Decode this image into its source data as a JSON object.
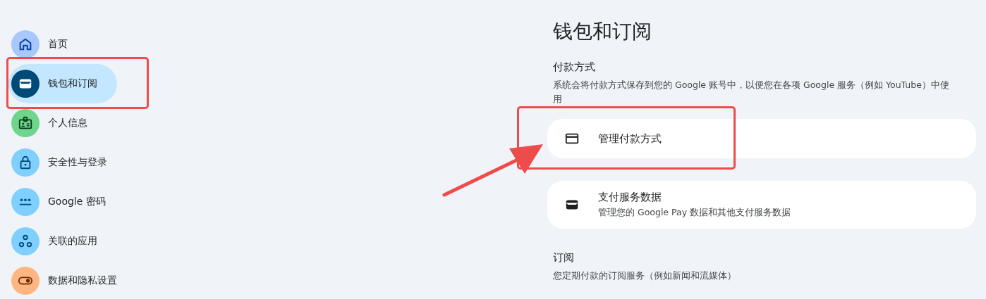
{
  "sidebar": {
    "items": [
      {
        "label": "首页",
        "kind": "home",
        "selected": false,
        "annotated": false
      },
      {
        "label": "钱包和订阅",
        "kind": "wallet",
        "selected": true,
        "annotated": true
      },
      {
        "label": "个人信息",
        "kind": "badge",
        "selected": false,
        "annotated": false
      },
      {
        "label": "安全性与登录",
        "kind": "lock",
        "selected": false,
        "annotated": false
      },
      {
        "label": "Google 密码",
        "kind": "password",
        "selected": false,
        "annotated": false
      },
      {
        "label": "关联的应用",
        "kind": "apps",
        "selected": false,
        "annotated": false
      },
      {
        "label": "数据和隐私设置",
        "kind": "toggle",
        "selected": false,
        "annotated": false
      }
    ]
  },
  "main": {
    "title": "钱包和订阅",
    "sections": [
      {
        "heading": "付款方式",
        "description": "系统会将付款方式保存到您的 Google 账号中，以便您在各项 Google 服务（例如 YouTube）中使用",
        "cards": [
          {
            "kind": "card",
            "title": "管理付款方式",
            "annotated": true
          },
          {
            "kind": "wallet",
            "title": "支付服务数据",
            "subtitle": "管理您的 Google Pay 数据和其他支付服务数据",
            "annotated": false
          }
        ]
      },
      {
        "heading": "订阅",
        "description": "您定期付款的订阅服务（例如新闻和流媒体）"
      }
    ]
  }
}
